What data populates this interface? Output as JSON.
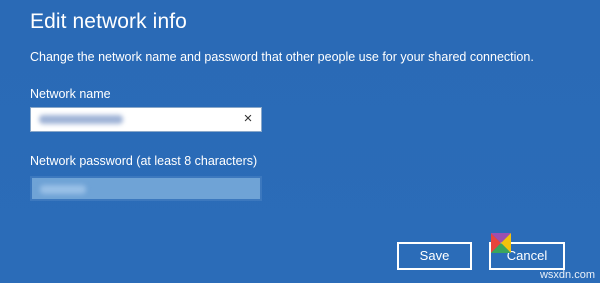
{
  "dialog": {
    "title": "Edit network info",
    "description": "Change the network name and password that other people use for your shared connection."
  },
  "fields": {
    "name_label": "Network name",
    "password_label": "Network password (at least 8 characters)",
    "clear_glyph": "×"
  },
  "buttons": {
    "save_label": "Save",
    "cancel_label": "Cancel"
  },
  "watermark": {
    "text": "wsxdn.com"
  },
  "colors": {
    "background": "#2b6cb8",
    "password_field": "#6fa3d6",
    "text": "#ffffff"
  },
  "icons": {
    "clear": "close-icon",
    "logo": "wsxdn-logo-icon"
  }
}
